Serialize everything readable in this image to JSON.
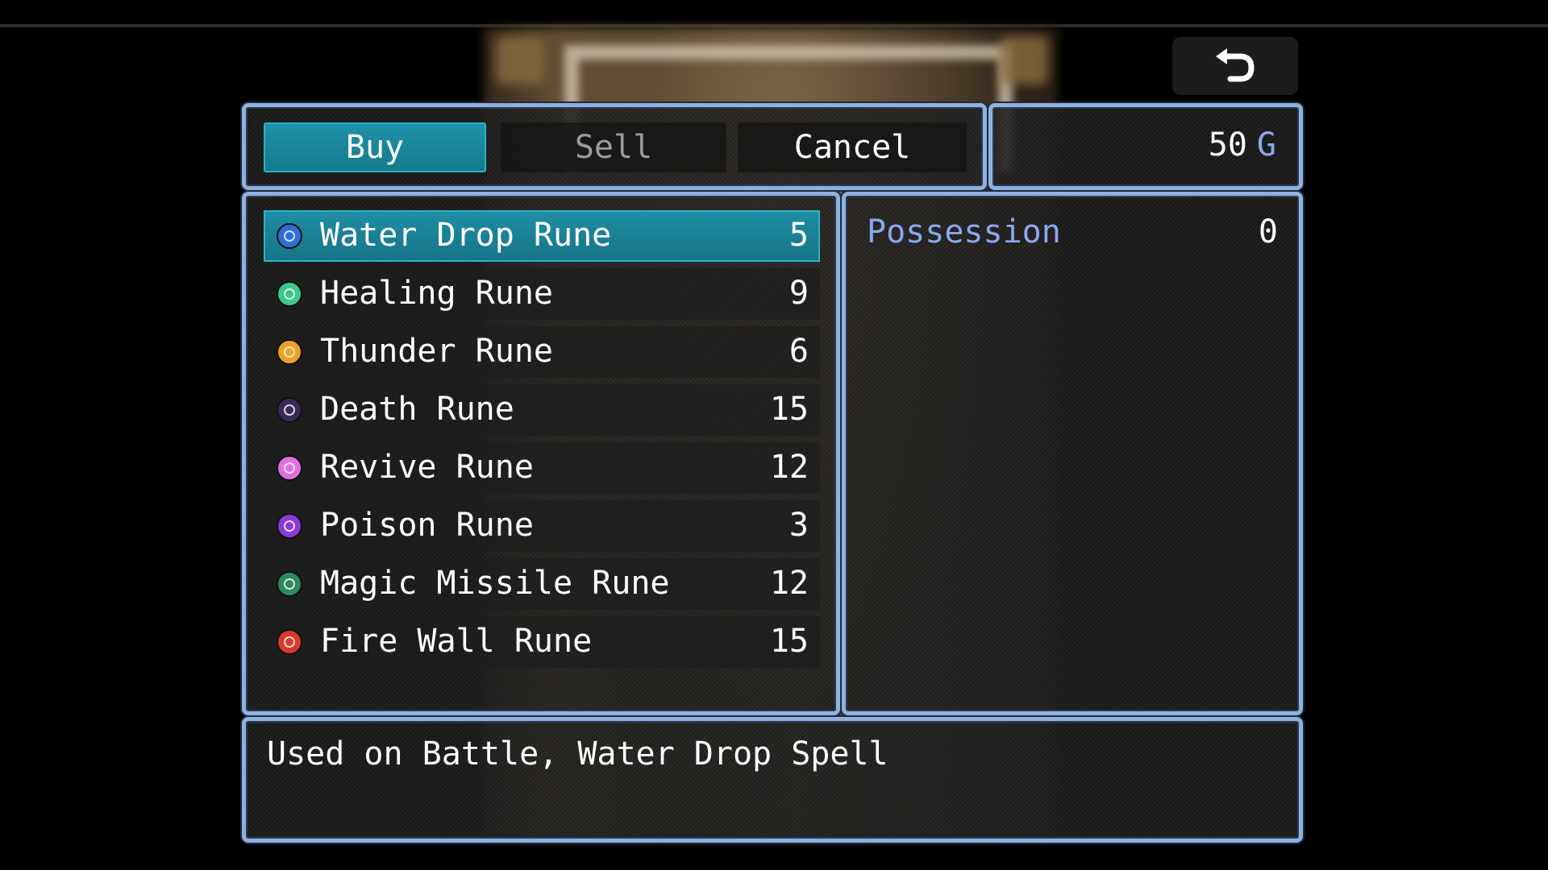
{
  "shop": {
    "commands": {
      "buy": "Buy",
      "sell": "Sell",
      "cancel": "Cancel"
    },
    "gold": {
      "amount": "50",
      "unit": "G"
    },
    "items": [
      {
        "name": "Water Drop Rune",
        "price": "5",
        "icon": "water-drop-rune-icon",
        "color": "#2b6fd6"
      },
      {
        "name": "Healing Rune",
        "price": "9",
        "icon": "healing-rune-icon",
        "color": "#3cc98a"
      },
      {
        "name": "Thunder Rune",
        "price": "6",
        "icon": "thunder-rune-icon",
        "color": "#f0a020"
      },
      {
        "name": "Death Rune",
        "price": "15",
        "icon": "death-rune-icon",
        "color": "#3a2a55"
      },
      {
        "name": "Revive Rune",
        "price": "12",
        "icon": "revive-rune-icon",
        "color": "#e070e0"
      },
      {
        "name": "Poison Rune",
        "price": "3",
        "icon": "poison-rune-icon",
        "color": "#8a3ad8"
      },
      {
        "name": "Magic Missile Rune",
        "price": "12",
        "icon": "magic-missile-rune-icon",
        "color": "#2e8a5a"
      },
      {
        "name": "Fire Wall Rune",
        "price": "15",
        "icon": "fire-wall-rune-icon",
        "color": "#d83a2a"
      }
    ],
    "selected_index": 0,
    "status": {
      "label": "Possession",
      "value": "0"
    },
    "help": "Used on Battle, Water Drop Spell"
  },
  "colors": {
    "window_border": "#8fb1dc",
    "selection": "#1f8fa4",
    "system_text": "#8aa8f0"
  }
}
